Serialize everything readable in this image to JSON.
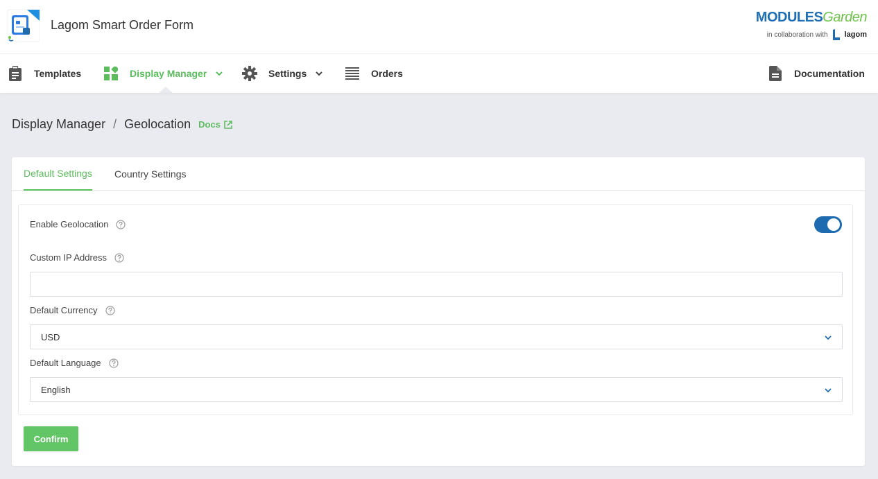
{
  "app": {
    "title": "Lagom Smart Order Form",
    "brand_modules": "MODULES",
    "brand_garden": "Garden",
    "brand_collab": "in collaboration with",
    "brand_partner": "lagom"
  },
  "nav": {
    "items": [
      {
        "label": "Templates",
        "icon": "clipboard-icon"
      },
      {
        "label": "Display Manager",
        "icon": "widgets-icon",
        "active": true,
        "dropdown": true
      },
      {
        "label": "Settings",
        "icon": "gear-icon",
        "dropdown": true
      },
      {
        "label": "Orders",
        "icon": "list-icon"
      }
    ],
    "documentation": {
      "label": "Documentation",
      "icon": "document-icon"
    }
  },
  "breadcrumb": {
    "parent": "Display Manager",
    "separator": "/",
    "current": "Geolocation",
    "docs_label": "Docs"
  },
  "tabs": [
    {
      "label": "Default Settings",
      "active": true
    },
    {
      "label": "Country Settings",
      "active": false
    }
  ],
  "form": {
    "enable_geolocation": {
      "label": "Enable Geolocation",
      "enabled": true
    },
    "custom_ip": {
      "label": "Custom IP Address",
      "value": "",
      "placeholder": ""
    },
    "default_currency": {
      "label": "Default Currency",
      "value": "USD"
    },
    "default_language": {
      "label": "Default Language",
      "value": "English"
    },
    "confirm_label": "Confirm"
  },
  "colors": {
    "accent_green": "#5cbd5e",
    "toggle_blue": "#1e6bb0",
    "background": "#eaebf0"
  }
}
